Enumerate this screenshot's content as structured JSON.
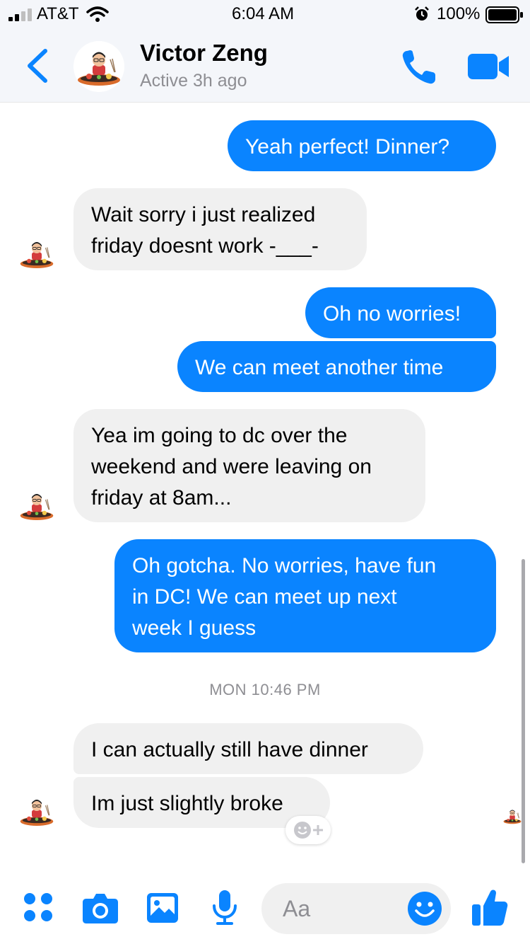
{
  "status_bar": {
    "carrier": "AT&T",
    "time": "6:04 AM",
    "battery": "100%"
  },
  "header": {
    "contact_name": "Victor Zeng",
    "presence": "Active 3h ago"
  },
  "messages": [
    {
      "direction": "outgoing",
      "text": "Yeah perfect! Dinner?"
    },
    {
      "direction": "incoming",
      "text": "Wait sorry i just realized\nfriday doesnt work -___-"
    },
    {
      "direction": "outgoing",
      "text": "Oh no worries!"
    },
    {
      "direction": "outgoing",
      "text": "We can meet another time"
    },
    {
      "direction": "incoming",
      "text": "Yea im going to dc over the\nweekend and were leaving on\nfriday at 8am..."
    },
    {
      "direction": "outgoing",
      "text": "Oh gotcha. No worries, have fun\nin DC! We can meet up next\nweek I guess"
    },
    {
      "direction": "incoming",
      "text": "I can actually still have dinner"
    },
    {
      "direction": "incoming",
      "text": "Im just slightly broke"
    }
  ],
  "timestamp_divider": "MON 10:46 PM",
  "composer": {
    "placeholder": "Aa"
  },
  "colors": {
    "accent": "#0a84ff",
    "incoming_bubble": "#f0f0f0",
    "muted_text": "#8e8e93"
  },
  "icons": [
    "signal-icon",
    "wifi-icon",
    "alarm-icon",
    "battery-icon",
    "back-chevron-icon",
    "phone-icon",
    "video-camera-icon",
    "more-apps-icon",
    "camera-icon",
    "photo-gallery-icon",
    "microphone-icon",
    "emoji-icon",
    "thumbs-up-icon",
    "add-reaction-icon"
  ]
}
